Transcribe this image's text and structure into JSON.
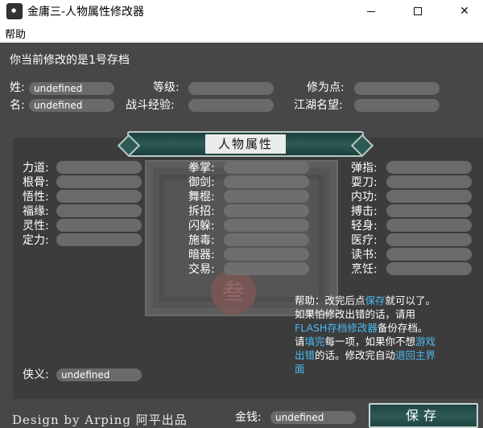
{
  "window": {
    "title": "金庸三-人物属性修改器",
    "minimize_icon": "minimize-icon",
    "maximize_icon": "maximize-icon",
    "close_icon": "close-icon"
  },
  "menu": {
    "help": "帮助"
  },
  "header": {
    "current_save": "你当前修改的是1号存档",
    "surname_label": "姓:",
    "surname_value": "undefined",
    "name_label": "名:",
    "name_value": "undefined",
    "level_label": "等级:",
    "level_value": "",
    "exp_label": "战斗经验:",
    "exp_value": "",
    "cultivation_label": "修为点:",
    "cultivation_value": "",
    "reputation_label": "江湖名望:",
    "reputation_value": ""
  },
  "panel": {
    "title": "人物属性",
    "left": [
      {
        "label": "力道:",
        "value": ""
      },
      {
        "label": "根骨:",
        "value": ""
      },
      {
        "label": "悟性:",
        "value": ""
      },
      {
        "label": "福缘:",
        "value": ""
      },
      {
        "label": "灵性:",
        "value": ""
      },
      {
        "label": "定力:",
        "value": ""
      }
    ],
    "middle": [
      {
        "label": "拳掌:",
        "value": ""
      },
      {
        "label": "御剑:",
        "value": ""
      },
      {
        "label": "舞棍:",
        "value": ""
      },
      {
        "label": "拆招:",
        "value": ""
      },
      {
        "label": "闪躲:",
        "value": ""
      },
      {
        "label": "施毒:",
        "value": ""
      },
      {
        "label": "暗器:",
        "value": ""
      },
      {
        "label": "交易:",
        "value": ""
      }
    ],
    "right": [
      {
        "label": "弹指:",
        "value": ""
      },
      {
        "label": "耍刀:",
        "value": ""
      },
      {
        "label": "内功:",
        "value": ""
      },
      {
        "label": "搏击:",
        "value": ""
      },
      {
        "label": "轻身:",
        "value": ""
      },
      {
        "label": "医疗:",
        "value": ""
      },
      {
        "label": "读书:",
        "value": ""
      },
      {
        "label": "烹饪:",
        "value": ""
      }
    ],
    "righteousness_label": "侠义:",
    "righteousness_value": "undefined",
    "seal_glyph": "叁"
  },
  "help": {
    "l1a": "帮助：改完后点",
    "l1b": "保存",
    "l1c": "就可以了。",
    "l2": "如果怕修改出错的话，请用",
    "l3a": "FLASH存档修改器",
    "l3b": "备份存档。",
    "l4a": "请",
    "l4b": "填完",
    "l4c": "每一项，如果你不想",
    "l4d": "游戏",
    "l5a": "出错",
    "l5b": "的话。修改完自动",
    "l5c": "退回主界",
    "l6": "面"
  },
  "footer": {
    "brand": "Design by Arping 阿平出品",
    "money_label": "金钱:",
    "money_value": "undefined",
    "save_button": "保存"
  },
  "colors": {
    "background": "#474747",
    "field": "#6a6a6a",
    "link": "#4cb8f2",
    "accent": "#2c5a55"
  }
}
